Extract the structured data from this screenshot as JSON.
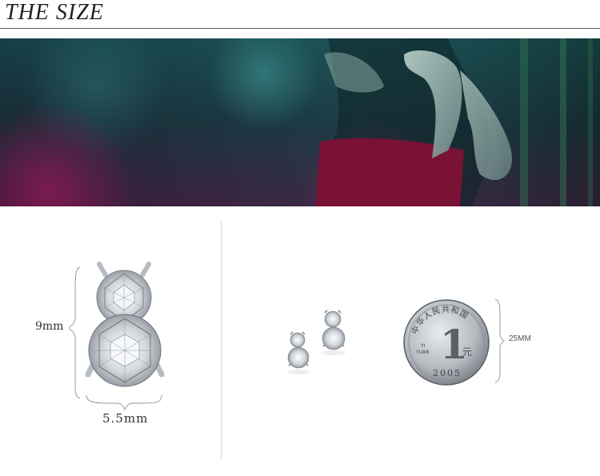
{
  "header": {
    "title": "THE SIZE"
  },
  "diagram": {
    "height_label": "9mm",
    "width_label": "5.5mm"
  },
  "comparison": {
    "size_label": "25MM",
    "coin": {
      "top_text": "中华人民共和国",
      "denomination": "1",
      "unit": "元",
      "pinyin_1": "YI",
      "pinyin_2": "YUAN",
      "year": "2005"
    }
  },
  "colors": {
    "accent": "#222222",
    "banner_dark": "#1b2c34",
    "banner_magenta": "#6a1245"
  }
}
